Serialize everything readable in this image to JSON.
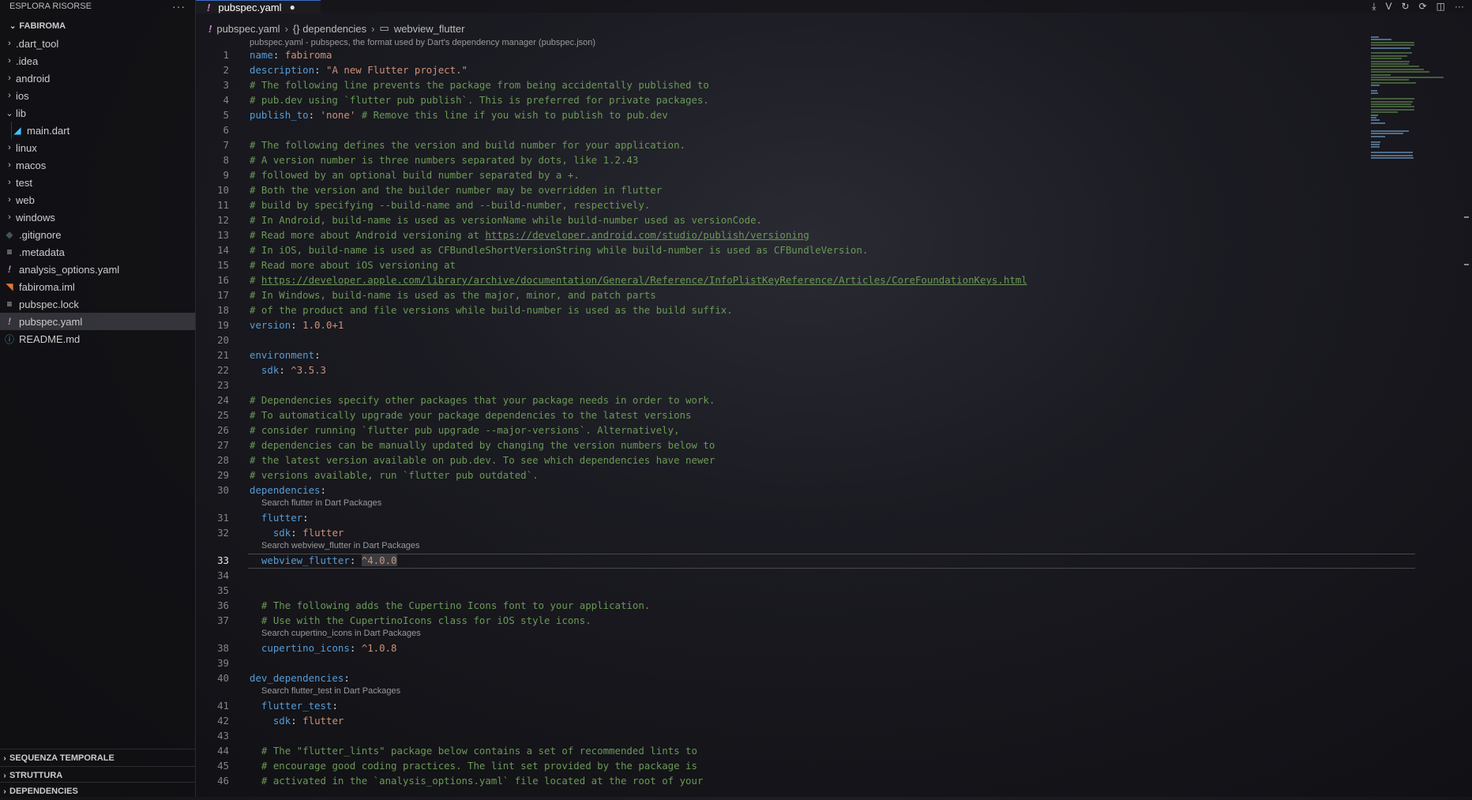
{
  "sidebar": {
    "header_title": "ESPLORA RISORSE",
    "more_label": "···",
    "section_title": "FABIROMA",
    "items": [
      {
        "label": ".dart_tool",
        "kind": "folder",
        "expanded": false,
        "icon": "chevron-right-icon"
      },
      {
        "label": ".idea",
        "kind": "folder",
        "expanded": false,
        "icon": "chevron-right-icon"
      },
      {
        "label": "android",
        "kind": "folder",
        "expanded": false,
        "icon": "chevron-right-icon"
      },
      {
        "label": "ios",
        "kind": "folder",
        "expanded": false,
        "icon": "chevron-right-icon"
      },
      {
        "label": "lib",
        "kind": "folder",
        "expanded": true,
        "icon": "chevron-down-icon"
      },
      {
        "label": "main.dart",
        "kind": "file",
        "icon": "dart-file-icon",
        "glyph": "◢",
        "color": "#40c4ff"
      },
      {
        "label": "linux",
        "kind": "folder",
        "expanded": false,
        "icon": "chevron-right-icon"
      },
      {
        "label": "macos",
        "kind": "folder",
        "expanded": false,
        "icon": "chevron-right-icon"
      },
      {
        "label": "test",
        "kind": "folder",
        "expanded": false,
        "icon": "chevron-right-icon"
      },
      {
        "label": "web",
        "kind": "folder",
        "expanded": false,
        "icon": "chevron-right-icon"
      },
      {
        "label": "windows",
        "kind": "folder",
        "expanded": false,
        "icon": "chevron-right-icon"
      },
      {
        "label": ".gitignore",
        "kind": "file",
        "icon": "git-icon",
        "glyph": "◆",
        "color": "#41535b"
      },
      {
        "label": ".metadata",
        "kind": "file",
        "icon": "lines-file-icon",
        "glyph": "≡",
        "color": "#cccccc"
      },
      {
        "label": "analysis_options.yaml",
        "kind": "file",
        "icon": "yaml-icon",
        "glyph": "!",
        "color": "#c586c0"
      },
      {
        "label": "fabiroma.iml",
        "kind": "file",
        "icon": "rss-icon",
        "glyph": "◥",
        "color": "#e37933"
      },
      {
        "label": "pubspec.lock",
        "kind": "file",
        "icon": "lines-file-icon",
        "glyph": "≡",
        "color": "#cccccc"
      },
      {
        "label": "pubspec.yaml",
        "kind": "file",
        "icon": "yaml-icon",
        "glyph": "!",
        "color": "#c586c0",
        "active": true
      },
      {
        "label": "README.md",
        "kind": "file",
        "icon": "info-icon",
        "glyph": "ⓘ",
        "color": "#519aba"
      }
    ],
    "bottom_sections": [
      "SEQUENZA TEMPORALE",
      "STRUTTURA",
      "DEPENDENCIES"
    ]
  },
  "tab": {
    "label": "pubspec.yaml",
    "modified_glyph": "●",
    "icon_glyph": "!"
  },
  "tab_actions": [
    {
      "name": "download-icon",
      "glyph": "⤓"
    },
    {
      "name": "v-icon",
      "glyph": "V"
    },
    {
      "name": "refresh-icon",
      "glyph": "↻"
    },
    {
      "name": "restart-icon",
      "glyph": "⟳"
    },
    {
      "name": "split-editor-icon",
      "glyph": "◫"
    },
    {
      "name": "more-actions-icon",
      "glyph": "···"
    }
  ],
  "breadcrumb": {
    "file": "pubspec.yaml",
    "file_icon": "!",
    "dependencies": "{} dependencies",
    "leaf_icon": "▭",
    "leaf": "webview_flutter"
  },
  "editor": {
    "schema_hint": "pubspec.yaml - pubspecs, the format used by Dart's dependency manager (pubspec.json)",
    "current_line": 33,
    "code_lens": [
      {
        "before_line": 31,
        "text": "Search flutter in Dart Packages"
      },
      {
        "before_line": 33,
        "text": "Search webview_flutter in Dart Packages"
      },
      {
        "before_line": 38,
        "text": "Search cupertino_icons in Dart Packages"
      },
      {
        "before_line": 41,
        "text": "Search flutter_test in Dart Packages"
      }
    ],
    "lines": [
      {
        "n": 1,
        "t": [
          [
            "k",
            "name"
          ],
          [
            "p",
            ": "
          ],
          [
            "s",
            "fabiroma"
          ]
        ]
      },
      {
        "n": 2,
        "t": [
          [
            "k",
            "description"
          ],
          [
            "p",
            ": "
          ],
          [
            "s",
            "\"A new Flutter project.\""
          ]
        ]
      },
      {
        "n": 3,
        "t": [
          [
            "c",
            "# The following line prevents the package from being accidentally published to"
          ]
        ]
      },
      {
        "n": 4,
        "t": [
          [
            "c",
            "# pub.dev using `flutter pub publish`. This is preferred for private packages."
          ]
        ]
      },
      {
        "n": 5,
        "t": [
          [
            "k",
            "publish_to"
          ],
          [
            "p",
            ": "
          ],
          [
            "s",
            "'none'"
          ],
          [
            "c",
            " # Remove this line if you wish to publish to pub.dev"
          ]
        ]
      },
      {
        "n": 6,
        "t": []
      },
      {
        "n": 7,
        "t": [
          [
            "c",
            "# The following defines the version and build number for your application."
          ]
        ]
      },
      {
        "n": 8,
        "t": [
          [
            "c",
            "# A version number is three numbers separated by dots, like 1.2.43"
          ]
        ]
      },
      {
        "n": 9,
        "t": [
          [
            "c",
            "# followed by an optional build number separated by a +."
          ]
        ]
      },
      {
        "n": 10,
        "t": [
          [
            "c",
            "# Both the version and the builder number may be overridden in flutter"
          ]
        ]
      },
      {
        "n": 11,
        "t": [
          [
            "c",
            "# build by specifying --build-name and --build-number, respectively."
          ]
        ]
      },
      {
        "n": 12,
        "t": [
          [
            "c",
            "# In Android, build-name is used as versionName while build-number used as versionCode."
          ]
        ]
      },
      {
        "n": 13,
        "t": [
          [
            "c",
            "# Read more about Android versioning at "
          ],
          [
            "u",
            "https://developer.android.com/studio/publish/versioning"
          ]
        ]
      },
      {
        "n": 14,
        "t": [
          [
            "c",
            "# In iOS, build-name is used as CFBundleShortVersionString while build-number is used as CFBundleVersion."
          ]
        ]
      },
      {
        "n": 15,
        "t": [
          [
            "c",
            "# Read more about iOS versioning at"
          ]
        ]
      },
      {
        "n": 16,
        "t": [
          [
            "c",
            "# "
          ],
          [
            "u",
            "https://developer.apple.com/library/archive/documentation/General/Reference/InfoPlistKeyReference/Articles/CoreFoundationKeys.html"
          ]
        ]
      },
      {
        "n": 17,
        "t": [
          [
            "c",
            "# In Windows, build-name is used as the major, minor, and patch parts"
          ]
        ]
      },
      {
        "n": 18,
        "t": [
          [
            "c",
            "# of the product and file versions while build-number is used as the build suffix."
          ]
        ]
      },
      {
        "n": 19,
        "t": [
          [
            "k",
            "version"
          ],
          [
            "p",
            ": "
          ],
          [
            "s",
            "1.0.0+1"
          ]
        ]
      },
      {
        "n": 20,
        "t": []
      },
      {
        "n": 21,
        "t": [
          [
            "k",
            "environment"
          ],
          [
            "p",
            ":"
          ]
        ]
      },
      {
        "n": 22,
        "t": [
          [
            "p",
            "  "
          ],
          [
            "k",
            "sdk"
          ],
          [
            "p",
            ": "
          ],
          [
            "s",
            "^3.5.3"
          ]
        ]
      },
      {
        "n": 23,
        "t": []
      },
      {
        "n": 24,
        "t": [
          [
            "c",
            "# Dependencies specify other packages that your package needs in order to work."
          ]
        ]
      },
      {
        "n": 25,
        "t": [
          [
            "c",
            "# To automatically upgrade your package dependencies to the latest versions"
          ]
        ]
      },
      {
        "n": 26,
        "t": [
          [
            "c",
            "# consider running `flutter pub upgrade --major-versions`. Alternatively,"
          ]
        ]
      },
      {
        "n": 27,
        "t": [
          [
            "c",
            "# dependencies can be manually updated by changing the version numbers below to"
          ]
        ]
      },
      {
        "n": 28,
        "t": [
          [
            "c",
            "# the latest version available on pub.dev. To see which dependencies have newer"
          ]
        ]
      },
      {
        "n": 29,
        "t": [
          [
            "c",
            "# versions available, run `flutter pub outdated`."
          ]
        ]
      },
      {
        "n": 30,
        "t": [
          [
            "k",
            "dependencies"
          ],
          [
            "p",
            ":"
          ]
        ]
      },
      {
        "n": 31,
        "t": [
          [
            "p",
            "  "
          ],
          [
            "k",
            "flutter"
          ],
          [
            "p",
            ":"
          ]
        ]
      },
      {
        "n": 32,
        "t": [
          [
            "p",
            "    "
          ],
          [
            "k",
            "sdk"
          ],
          [
            "p",
            ": "
          ],
          [
            "s",
            "flutter"
          ]
        ]
      },
      {
        "n": 33,
        "t": [
          [
            "p",
            "  "
          ],
          [
            "k",
            "webview_flutter"
          ],
          [
            "p",
            ": "
          ],
          [
            "sel",
            "^4.0.0"
          ]
        ]
      },
      {
        "n": 34,
        "t": []
      },
      {
        "n": 35,
        "t": []
      },
      {
        "n": 36,
        "t": [
          [
            "p",
            "  "
          ],
          [
            "c",
            "# The following adds the Cupertino Icons font to your application."
          ]
        ]
      },
      {
        "n": 37,
        "t": [
          [
            "p",
            "  "
          ],
          [
            "c",
            "# Use with the CupertinoIcons class for iOS style icons."
          ]
        ]
      },
      {
        "n": 38,
        "t": [
          [
            "p",
            "  "
          ],
          [
            "k",
            "cupertino_icons"
          ],
          [
            "p",
            ": "
          ],
          [
            "s",
            "^1.0.8"
          ]
        ]
      },
      {
        "n": 39,
        "t": []
      },
      {
        "n": 40,
        "t": [
          [
            "k",
            "dev_dependencies"
          ],
          [
            "p",
            ":"
          ]
        ]
      },
      {
        "n": 41,
        "t": [
          [
            "p",
            "  "
          ],
          [
            "k",
            "flutter_test"
          ],
          [
            "p",
            ":"
          ]
        ]
      },
      {
        "n": 42,
        "t": [
          [
            "p",
            "    "
          ],
          [
            "k",
            "sdk"
          ],
          [
            "p",
            ": "
          ],
          [
            "s",
            "flutter"
          ]
        ]
      },
      {
        "n": 43,
        "t": []
      },
      {
        "n": 44,
        "t": [
          [
            "p",
            "  "
          ],
          [
            "c",
            "# The \"flutter_lints\" package below contains a set of recommended lints to"
          ]
        ]
      },
      {
        "n": 45,
        "t": [
          [
            "p",
            "  "
          ],
          [
            "c",
            "# encourage good coding practices. The lint set provided by the package is"
          ]
        ]
      },
      {
        "n": 46,
        "t": [
          [
            "p",
            "  "
          ],
          [
            "c",
            "# activated in the `analysis_options.yaml` file located at the root of your"
          ]
        ]
      }
    ]
  },
  "colors": {
    "keyword": "#569cd6",
    "string": "#ce9178",
    "comment": "#6a9955",
    "accent": "#3b6fc9"
  }
}
